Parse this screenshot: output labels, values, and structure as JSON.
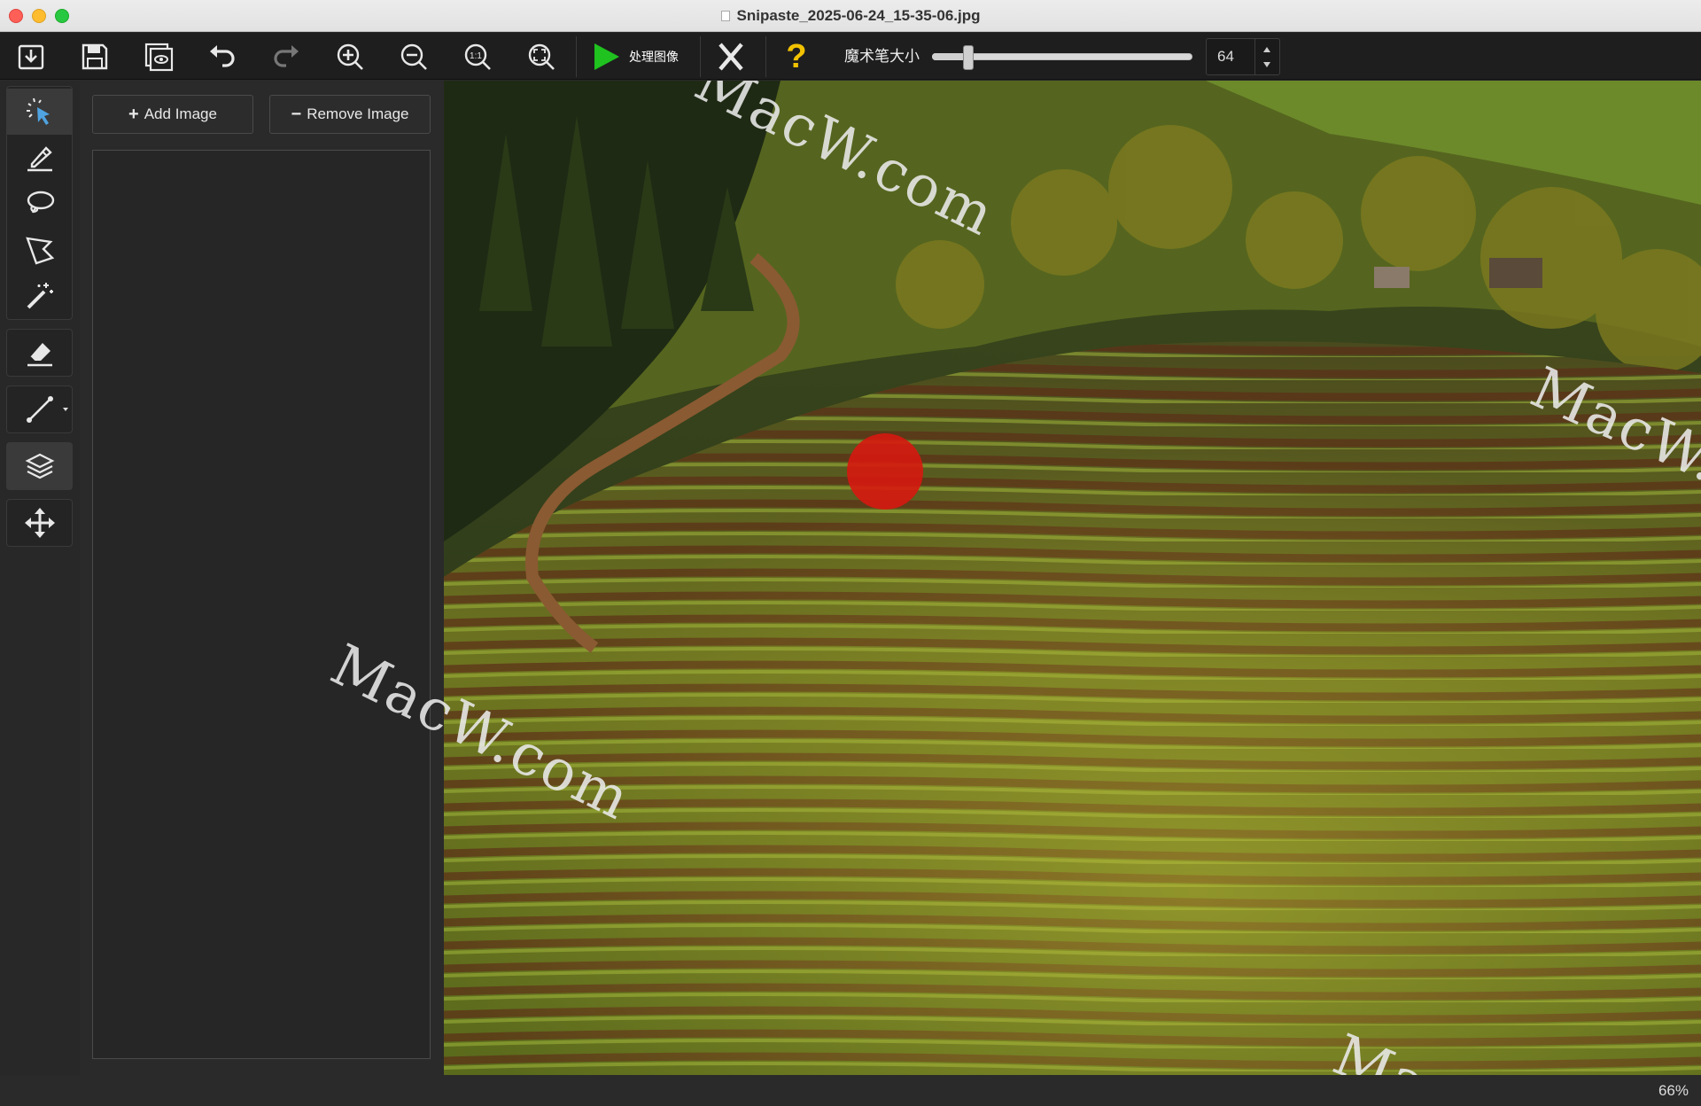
{
  "window": {
    "title": "Snipaste_2025-06-24_15-35-06.jpg"
  },
  "toolbar": {
    "buttons": [
      {
        "name": "open-image",
        "icon": "open-icon"
      },
      {
        "name": "save-image",
        "icon": "save-icon"
      },
      {
        "name": "preview",
        "icon": "preview-icon"
      },
      {
        "name": "undo",
        "icon": "undo-icon"
      },
      {
        "name": "redo",
        "icon": "redo-icon"
      },
      {
        "name": "zoom-in",
        "icon": "zoom-in-icon"
      },
      {
        "name": "zoom-out",
        "icon": "zoom-out-icon"
      },
      {
        "name": "zoom-actual",
        "icon": "zoom-1-1-icon",
        "text": "1:1"
      },
      {
        "name": "zoom-fit",
        "icon": "zoom-fit-icon"
      }
    ],
    "process_label": "处理图像",
    "brush_size_label": "魔术笔大小",
    "brush_size_value": "64",
    "brush_size_fraction": 0.14,
    "help_symbol": "?",
    "process_color": "#1fc21f",
    "help_color": "#f2c200"
  },
  "tools": [
    {
      "name": "select",
      "icon": "magic-select-icon"
    },
    {
      "name": "marker",
      "icon": "marker-icon"
    },
    {
      "name": "lasso",
      "icon": "lasso-icon"
    },
    {
      "name": "polygon-lasso",
      "icon": "polygon-lasso-icon"
    },
    {
      "name": "magic-wand",
      "icon": "magic-wand-icon"
    },
    {
      "name": "eraser",
      "icon": "eraser-icon"
    },
    {
      "name": "line",
      "icon": "line-icon"
    },
    {
      "name": "layers",
      "icon": "layers-icon"
    },
    {
      "name": "move",
      "icon": "move-icon"
    }
  ],
  "panel": {
    "add_symbol": "+",
    "add_label": "Add Image",
    "remove_symbol": "−",
    "remove_label": "Remove Image"
  },
  "watermarks": [
    "MacW.com",
    "MacW.c",
    "MacW.com",
    "MacW"
  ],
  "status": {
    "zoom": "66%"
  }
}
